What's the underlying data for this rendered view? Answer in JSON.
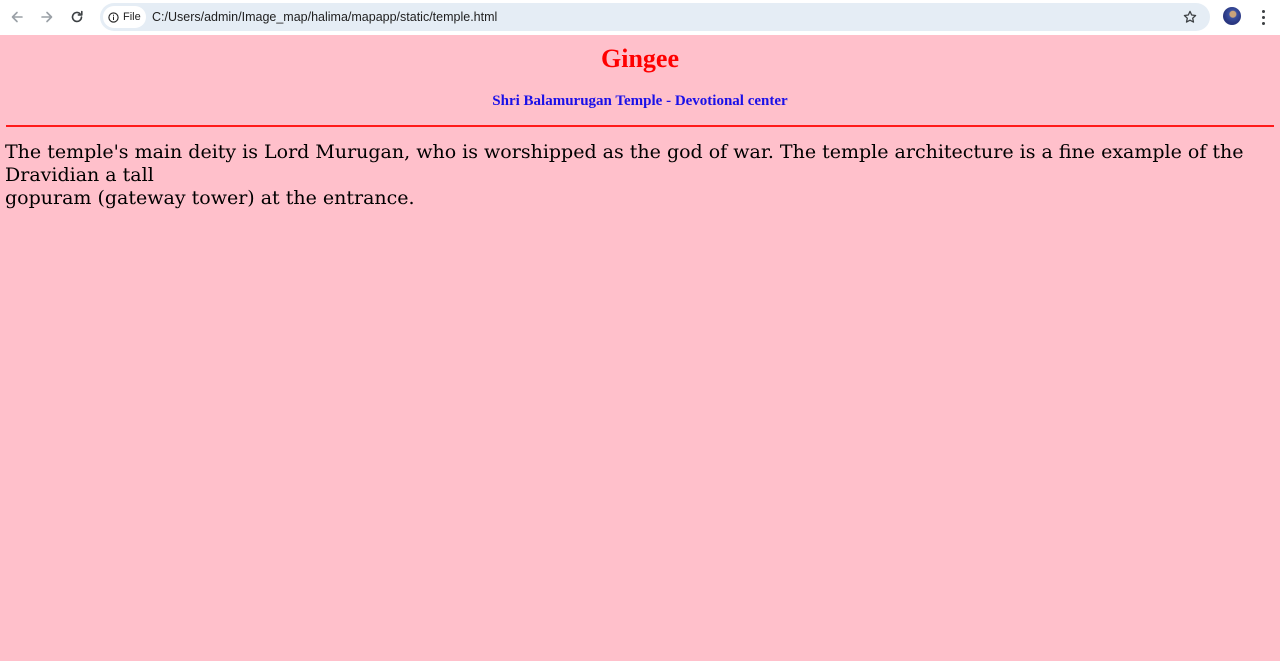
{
  "browser": {
    "address_bar": {
      "site_chip_label": "File",
      "url": "C:/Users/admin/Image_map/halima/mapapp/static/temple.html"
    },
    "icons": {
      "back": "arrow-left-icon",
      "forward": "arrow-right-icon",
      "reload": "reload-icon",
      "site_info": "info-icon",
      "bookmark": "star-icon",
      "menu": "kebab-menu-icon"
    }
  },
  "page": {
    "title": "Gingee",
    "subtitle": "Shri Balamurugan Temple - Devotional center",
    "description_line1": "The temple's main deity is Lord Murugan, who is worshipped as the god of war. The temple architecture is a fine example of the Dravidian a tall",
    "description_line2": "gopuram (gateway tower) at the entrance.",
    "colors": {
      "background": "#ffc0cb",
      "title": "#ff0000",
      "subtitle": "#1a10e8",
      "divider": "#ff1a1a"
    }
  }
}
